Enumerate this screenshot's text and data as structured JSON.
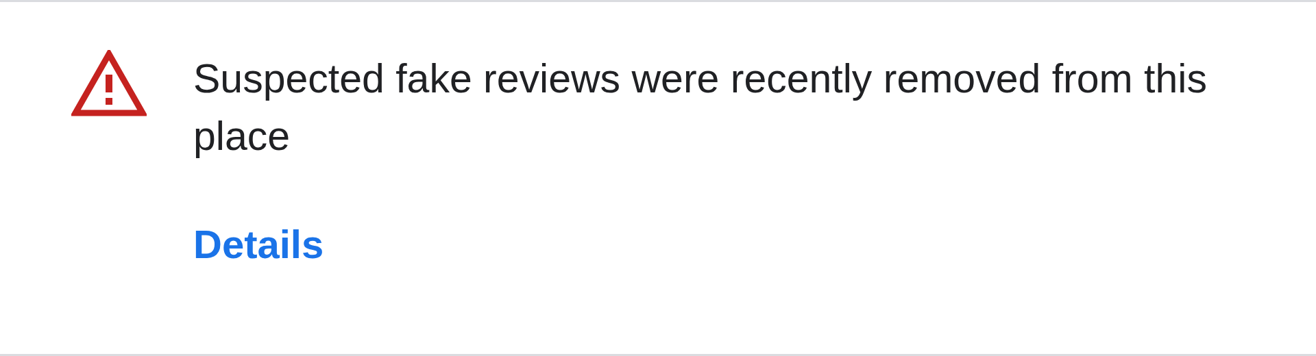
{
  "notice": {
    "message": "Suspected fake reviews were recently removed from this place",
    "link": "Details"
  }
}
